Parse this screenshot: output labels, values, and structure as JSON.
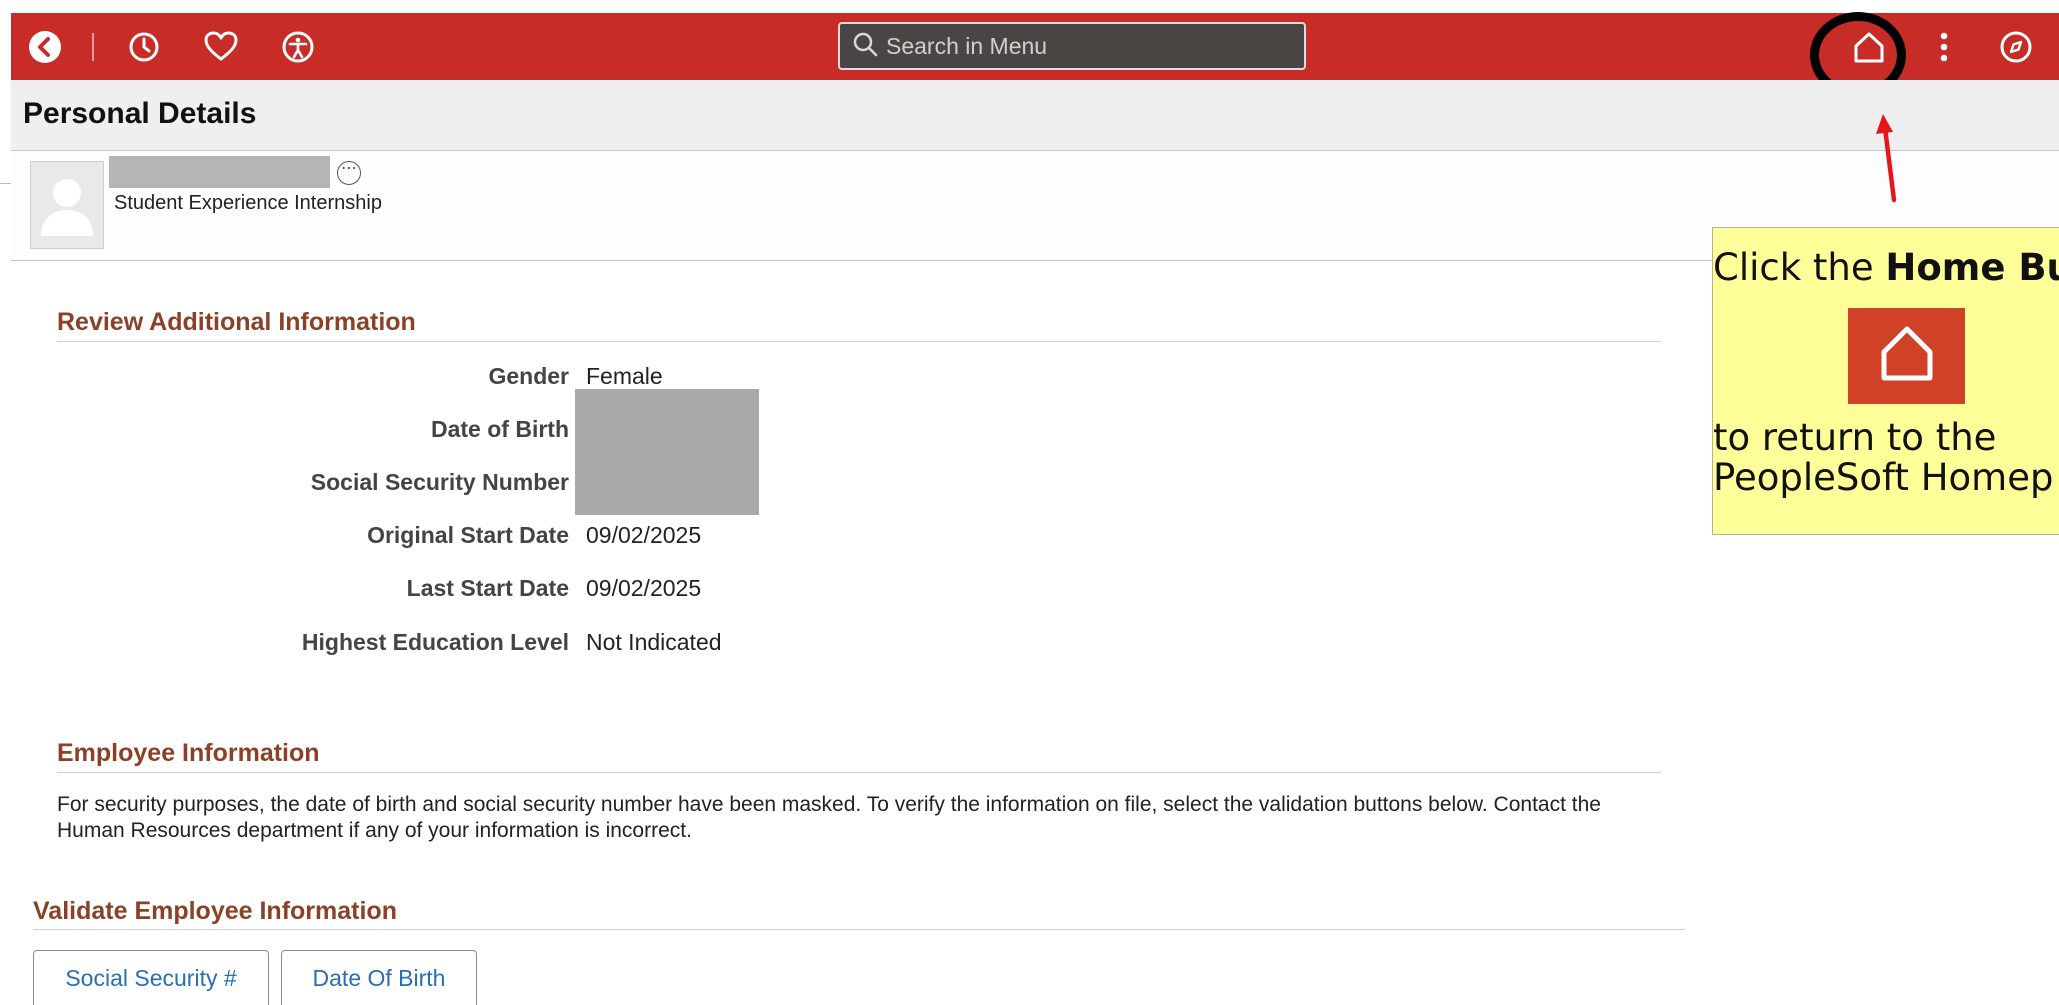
{
  "topbar": {
    "back_icon": "back-chevron-icon",
    "recent_icon": "clock-icon",
    "favorites_icon": "heart-icon",
    "accessibility_icon": "accessibility-icon",
    "search_placeholder": "Search in Menu",
    "home_icon": "home-icon",
    "actions_icon": "more-vertical-icon",
    "navbar_icon": "compass-icon",
    "bar_color": "#c72c27"
  },
  "page": {
    "title": "Personal Details"
  },
  "employee": {
    "job_title": "Student Experience Internship"
  },
  "review": {
    "heading": "Review Additional Information",
    "fields": [
      {
        "label": "Gender",
        "value": "Female"
      },
      {
        "label": "Date of Birth",
        "value": ""
      },
      {
        "label": "Social Security Number",
        "value": ""
      },
      {
        "label": "Original Start Date",
        "value": "09/02/2025"
      },
      {
        "label": "Last Start Date",
        "value": "09/02/2025"
      },
      {
        "label": "Highest Education Level",
        "value": "Not Indicated"
      }
    ]
  },
  "employee_info": {
    "heading": "Employee Information",
    "text": "For security purposes, the date of birth and social security number have been masked. To verify the information on file, select the validation buttons below. Contact the Human Resources department if any of your information is incorrect."
  },
  "validate": {
    "heading": "Validate Employee Information",
    "buttons": [
      "Social Security #",
      "Date Of Birth"
    ]
  },
  "callout": {
    "prefix": "Click the ",
    "bold": "Home But",
    "line2": "to return to the",
    "line3": "PeopleSoft Homep",
    "accent": "#d14128"
  }
}
